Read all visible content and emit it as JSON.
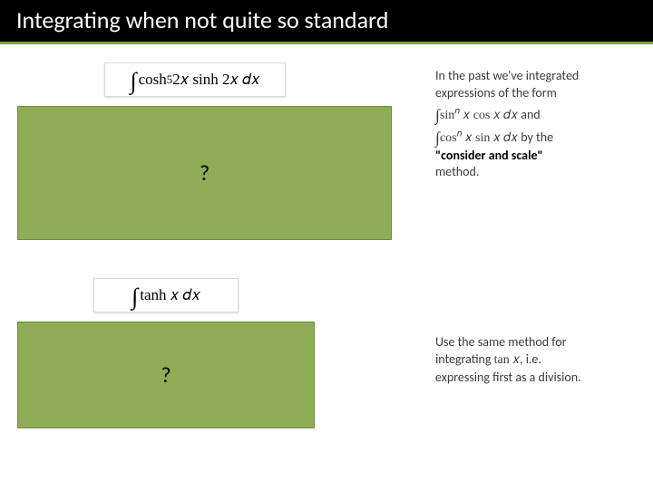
{
  "title": "Integrating when not quite so standard",
  "card1": {
    "int": "∫",
    "expr_a": "cosh",
    "sup": "5",
    "expr_b": " 2𝑥 sinh 2𝑥  𝑑𝑥"
  },
  "hidden1": {
    "mark": "?"
  },
  "card2": {
    "int": "∫",
    "expr": "tanh 𝑥  𝑑𝑥"
  },
  "hidden2": {
    "mark": "?"
  },
  "side1": {
    "l1": "In the past we've integrated",
    "l2": "expressions of the form",
    "m1_int": "∫",
    "m1_a": "sin",
    "m1_sup": "𝑛",
    "m1_b": " 𝑥 cos 𝑥  𝑑𝑥",
    "m1_tail": " and",
    "m2_int": "∫",
    "m2_a": "cos",
    "m2_sup": "𝑛",
    "m2_b": " 𝑥 sin 𝑥  𝑑𝑥",
    "m2_tail": " by the",
    "l5a": "\"consider and scale\"",
    "l5b": "method."
  },
  "side2": {
    "l1": "Use the same method for",
    "l2a": "integrating ",
    "l2b": "tan 𝑥",
    "l2c": ", i.e.",
    "l3": "expressing first as a division."
  }
}
